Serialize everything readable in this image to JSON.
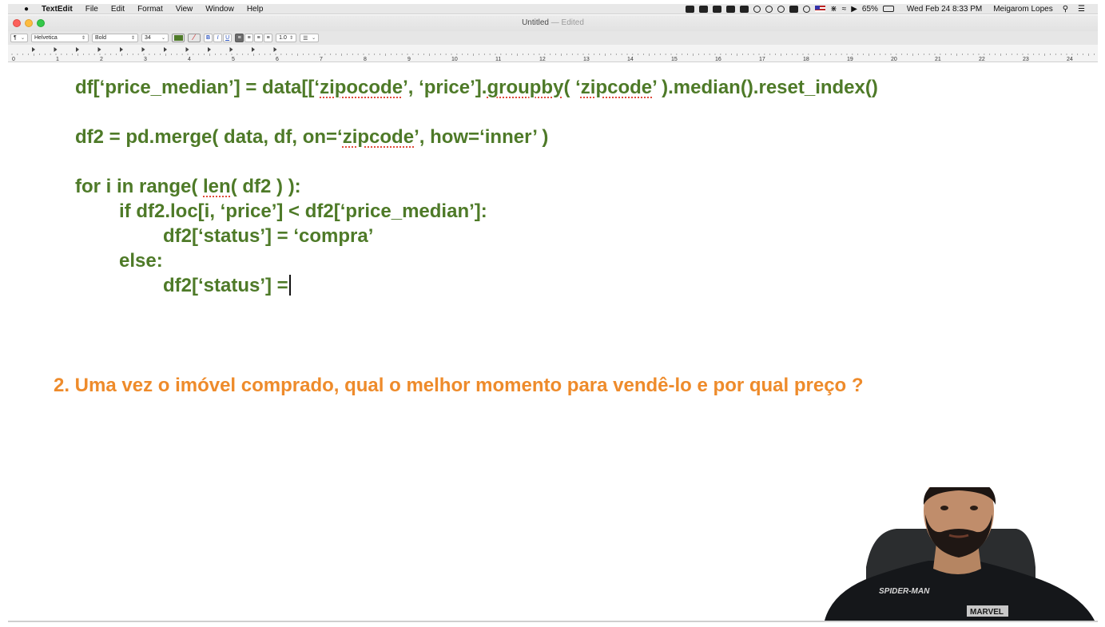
{
  "menubar": {
    "app_name": "TextEdit",
    "menus": [
      "File",
      "Edit",
      "Format",
      "View",
      "Window",
      "Help"
    ],
    "battery": "65%",
    "datetime": "Wed Feb 24  8:33 PM",
    "user": "Meigarom Lopes"
  },
  "window": {
    "title": "Untitled",
    "status": "Edited"
  },
  "toolbar": {
    "paragraph_style": "¶",
    "font_family": "Helvetica",
    "font_style": "Bold",
    "font_size": "34",
    "bold_label": "B",
    "italic_label": "I",
    "underline_label": "U",
    "line_spacing": "1.0",
    "text_color": "#4e7a28"
  },
  "ruler": {
    "numbers": [
      "0",
      "1",
      "2",
      "3",
      "4",
      "5",
      "6",
      "7",
      "8",
      "9",
      "10",
      "11",
      "12",
      "13",
      "14",
      "15",
      "16",
      "17",
      "18",
      "19",
      "20",
      "21",
      "22",
      "23",
      "24"
    ]
  },
  "document": {
    "code_lines": [
      "df[‘price_median’] = data[[‘zipocode’, ‘price’].groupby( ‘zipcode’ ).median().reset_index()",
      "df2 = pd.merge( data, df, on=‘zipcode’, how=‘inner’ )",
      "for i in range( len( df2 ) ):",
      "if df2.loc[i, ‘price’] < df2[‘price_median’]:",
      "df2[‘status’] = ‘compra’",
      "else:",
      "df2[‘status’] ="
    ],
    "question": "2. Uma vez o imóvel comprado, qual o melhor momento para vendê-lo e por qual preço ?",
    "code_color": "#4e7a28",
    "question_color": "#ee8b2b"
  },
  "webcam": {
    "shirt_text": "SPIDER-MAN",
    "shirt_brand": "MARVEL"
  }
}
